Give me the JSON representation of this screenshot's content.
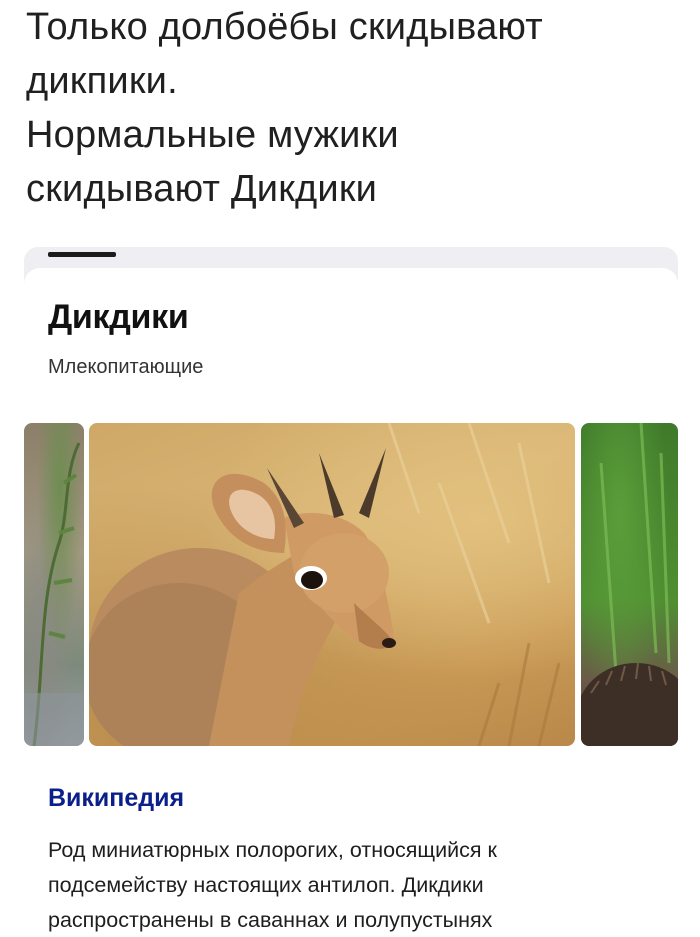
{
  "post": {
    "lines": [
      "Только долбоёбы скидывают",
      "дикпики.",
      "Нормальные мужики",
      "скидывают Дикдики"
    ]
  },
  "card": {
    "title": "Дикдики",
    "subtitle": "Млекопитающие",
    "images": [
      {
        "icon": "dikdik-habitat-photo-left"
      },
      {
        "icon": "dikdik-antelope-photo"
      },
      {
        "icon": "grass-hedgehog-photo-right"
      }
    ],
    "source": "Википедия",
    "description_lines": [
      "Род миниатюрных полорогих, относящийся к",
      "подсемейству настоящих антилоп. Дикдики",
      "распространены в саваннах и полупустынях"
    ]
  },
  "colors": {
    "source_link": "#0b1f8a",
    "card_bg": "#ffffff",
    "card_frame": "#efeff3"
  }
}
